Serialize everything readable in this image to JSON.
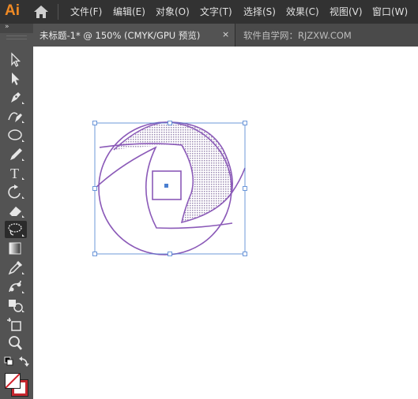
{
  "app": {
    "logo": "Ai"
  },
  "menu": {
    "items": [
      "文件(F)",
      "编辑(E)",
      "对象(O)",
      "文字(T)",
      "选择(S)",
      "效果(C)",
      "视图(V)",
      "窗口(W)"
    ]
  },
  "tabs": {
    "active_title": "未标题-1* @ 150% (CMYK/GPU 预览)",
    "close_glyph": "×",
    "watermark": "软件自学网：RJZXW.COM"
  },
  "toolbar": {
    "collapse_glyph": "»",
    "tools": [
      "selection-tool",
      "direct-selection-tool",
      "pen-tool",
      "curvature-tool",
      "ellipse-tool",
      "pencil-tool",
      "type-tool",
      "rotate-tool",
      "eraser-tool",
      "lasso-tool",
      "gradient-tool",
      "eyedropper-tool",
      "blend-tool",
      "shape-builder-tool",
      "artboard-tool",
      "zoom-tool"
    ],
    "active_tool": "lasso-tool",
    "type_glyph": "T"
  },
  "colors": {
    "accent": "#f08a24",
    "path_stroke": "#8b5ab8",
    "selection": "#4a7fd0",
    "fill_color": "#ffffff",
    "stroke_color": "#c4262e"
  }
}
